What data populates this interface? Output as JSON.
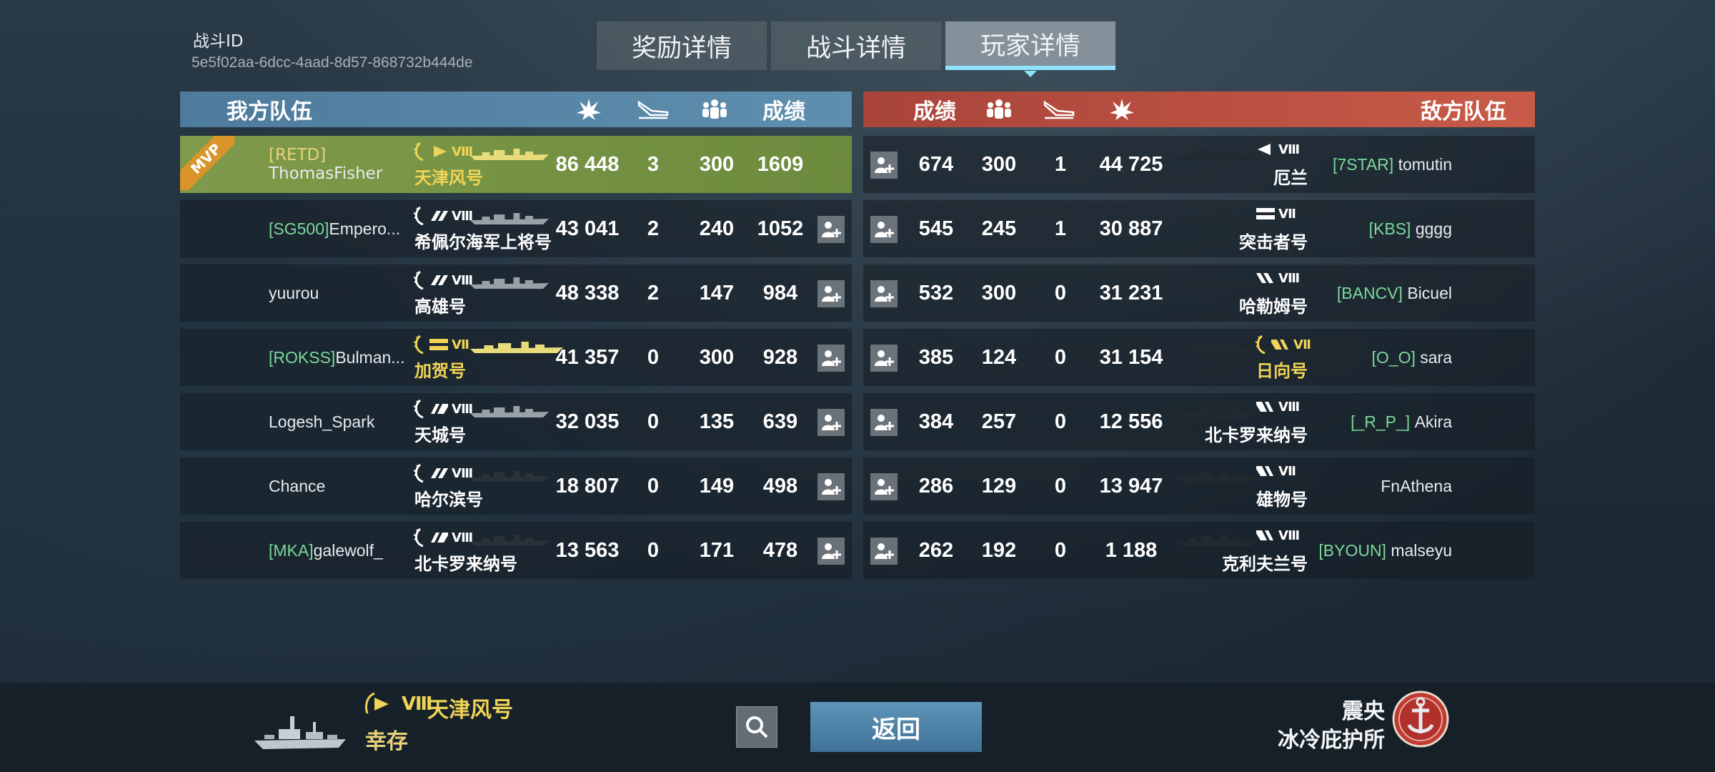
{
  "battle": {
    "id_label": "战斗ID",
    "id_value": "5e5f02aa-6dcc-4aad-8d57-868732b444de"
  },
  "tabs": [
    {
      "label": "奖励详情",
      "active": false
    },
    {
      "label": "战斗详情",
      "active": false
    },
    {
      "label": "玩家详情",
      "active": true
    }
  ],
  "ally_header": {
    "title": "我方队伍",
    "score_label": "成绩",
    "icons": [
      "explosion-icon",
      "plane-icon",
      "people-icon"
    ]
  },
  "enemy_header": {
    "title": "敌方队伍",
    "score_label": "成绩",
    "icons": [
      "people-icon",
      "plane-icon",
      "explosion-icon"
    ]
  },
  "ally_rows": [
    {
      "clan": "[RETD]",
      "name": "ThomasFisher",
      "ship": "天津风号",
      "tier": "Ⅷ",
      "ship_class": "destroyer",
      "premium": true,
      "damage": "86 448",
      "kills": "3",
      "xp": "300",
      "score": "1609",
      "mvp": true,
      "mvp_label": "MVP"
    },
    {
      "clan": "[SG500]",
      "name": "Empero...",
      "ship": "希佩尔海军上将号",
      "tier": "Ⅷ",
      "ship_class": "cruiser",
      "premium": false,
      "damage": "43 041",
      "kills": "2",
      "xp": "240",
      "score": "1052",
      "mvp": false
    },
    {
      "clan": "",
      "name": "yuurou",
      "ship": "高雄号",
      "tier": "Ⅷ",
      "ship_class": "cruiser",
      "premium": false,
      "damage": "48 338",
      "kills": "2",
      "xp": "147",
      "score": "984",
      "mvp": false
    },
    {
      "clan": "[ROKSS]",
      "name": "Bulman...",
      "ship": "加贺号",
      "tier": "Ⅶ",
      "ship_class": "carrier",
      "premium": true,
      "damage": "41 357",
      "kills": "0",
      "xp": "300",
      "score": "928",
      "mvp": false
    },
    {
      "clan": "",
      "name": "Logesh_Spark",
      "ship": "天城号",
      "tier": "Ⅷ",
      "ship_class": "battleship",
      "premium": false,
      "damage": "32 035",
      "kills": "0",
      "xp": "135",
      "score": "639",
      "mvp": false
    },
    {
      "clan": "",
      "name": "Chance",
      "ship": "哈尔滨号",
      "tier": "Ⅷ",
      "ship_class": "cruiser",
      "premium": false,
      "damage": "18 807",
      "kills": "0",
      "xp": "149",
      "score": "498",
      "mvp": false
    },
    {
      "clan": "[MKA]",
      "name": "galewolf_",
      "ship": "北卡罗来纳号",
      "tier": "Ⅷ",
      "ship_class": "battleship",
      "premium": false,
      "damage": "13 563",
      "kills": "0",
      "xp": "171",
      "score": "478",
      "mvp": false
    }
  ],
  "enemy_rows": [
    {
      "clan": "[7STAR]",
      "name": "tomutin",
      "ship": "厄兰",
      "tier": "Ⅷ",
      "ship_class": "destroyer",
      "premium": false,
      "damage": "44 725",
      "kills": "1",
      "xp": "300",
      "score": "674"
    },
    {
      "clan": "[KBS]",
      "name": "gggg",
      "ship": "突击者号",
      "tier": "Ⅶ",
      "ship_class": "carrier",
      "premium": false,
      "damage": "30 887",
      "kills": "1",
      "xp": "245",
      "score": "545"
    },
    {
      "clan": "[BANCV]",
      "name": "Bicuel",
      "ship": "哈勒姆号",
      "tier": "Ⅷ",
      "ship_class": "cruiser",
      "premium": false,
      "damage": "31 231",
      "kills": "0",
      "xp": "300",
      "score": "532"
    },
    {
      "clan": "[O_O]",
      "name": "sara",
      "ship": "日向号",
      "tier": "Ⅶ",
      "ship_class": "battleship",
      "premium": true,
      "damage": "31 154",
      "kills": "0",
      "xp": "124",
      "score": "385"
    },
    {
      "clan": "[_R_P_]",
      "name": "Akira",
      "ship": "北卡罗来纳号",
      "tier": "Ⅷ",
      "ship_class": "battleship",
      "premium": false,
      "damage": "12 556",
      "kills": "0",
      "xp": "257",
      "score": "384"
    },
    {
      "clan": "",
      "name": "FnAthena",
      "ship": "雄物号",
      "tier": "Ⅶ",
      "ship_class": "battleship",
      "premium": false,
      "damage": "13 947",
      "kills": "0",
      "xp": "129",
      "score": "286"
    },
    {
      "clan": "[BYOUN]",
      "name": "malseyu",
      "ship": "克利夫兰号",
      "tier": "Ⅷ",
      "ship_class": "battleship",
      "premium": false,
      "damage": "1 188",
      "kills": "0",
      "xp": "192",
      "score": "262"
    }
  ],
  "bottom": {
    "tier": "Ⅷ",
    "ship": "天津风号",
    "status": "幸存",
    "search_icon": "search-icon",
    "back_label": "返回",
    "right_line1": "震央",
    "right_line2": "冰冷庇护所"
  },
  "colors": {
    "ally": "#5f8fae",
    "enemy": "#c85b48",
    "clan": "#7cd89a",
    "gold": "#f0d456",
    "mvp_row": "#7f9a4a",
    "accent": "#8fe3ff"
  }
}
